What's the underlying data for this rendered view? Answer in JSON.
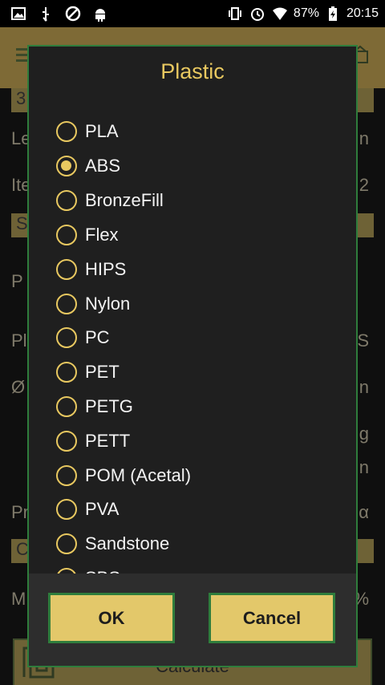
{
  "status_bar": {
    "battery": "87%",
    "time": "20:15"
  },
  "background": {
    "row_3_text": "3",
    "row_le": "Le",
    "row_ite": "Ite",
    "row_s": "S",
    "row_p1": "P",
    "row_pl": "Pl",
    "row_dia": "Ø",
    "row_pr": "Pr",
    "row_c": "C",
    "row_m": "M",
    "right_n1": "n",
    "right_2": "2",
    "right_s": "S",
    "right_n2": "n",
    "right_g": "g",
    "right_n3": "n",
    "right_a": "α",
    "right_pct": "%",
    "calculate_label": "Calculate"
  },
  "dialog": {
    "title": "Plastic",
    "options": [
      "PLA",
      "ABS",
      "BronzeFill",
      "Flex",
      "HIPS",
      "Nylon",
      "PC",
      "PET",
      "PETG",
      "PETT",
      "POM (Acetal)",
      "PVA",
      "Sandstone",
      "SBS"
    ],
    "selected": "ABS",
    "ok_label": "OK",
    "cancel_label": "Cancel"
  },
  "colors": {
    "accent": "#e8c860",
    "border_green": "#2f7d3c",
    "dialog_bg": "#1f1f1f",
    "button_bg": "#e3c86a"
  }
}
